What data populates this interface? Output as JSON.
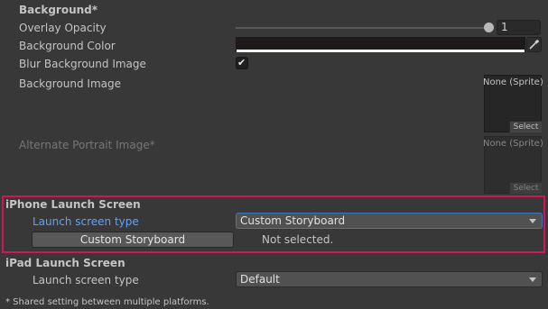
{
  "background_section": {
    "header": "Background*",
    "overlay_opacity": {
      "label": "Overlay Opacity",
      "value": "1",
      "level": 1.0
    },
    "background_color": {
      "label": "Background Color",
      "color": "#1f1a1a",
      "alpha_color": "#ffffff"
    },
    "blur_background_image": {
      "label": "Blur Background Image",
      "checked": true,
      "check_glyph": "✔"
    },
    "background_image": {
      "label": "Background Image",
      "none_text": "None (Sprite)",
      "select_label": "Select"
    },
    "alternate_portrait_image": {
      "label": "Alternate Portrait Image*",
      "none_text": "None (Sprite)",
      "select_label": "Select"
    }
  },
  "iphone_launch_screen": {
    "header": "iPhone Launch Screen",
    "launch_screen_type_label": "Launch screen type",
    "launch_screen_type_value": "Custom Storyboard",
    "storyboard_button_label": "Custom Storyboard",
    "storyboard_status": "Not selected.",
    "highlight_color": "#d4145a"
  },
  "ipad_launch_screen": {
    "header": "iPad Launch Screen",
    "launch_screen_type_label": "Launch screen type",
    "launch_screen_type_value": "Default"
  },
  "footer": {
    "note": "* Shared setting between multiple platforms."
  },
  "icons": {
    "eyedropper": "eyedropper-icon",
    "dropdown_caret": "caret-down-icon",
    "checkmark": "checkmark-icon"
  }
}
